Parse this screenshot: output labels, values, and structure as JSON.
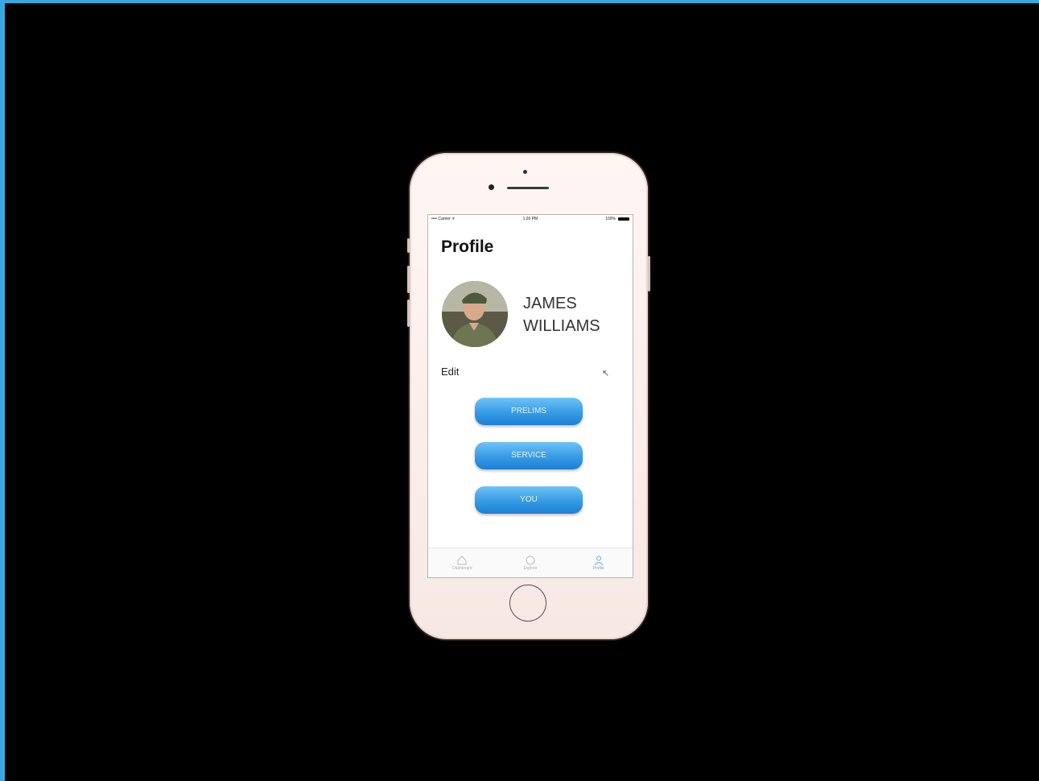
{
  "status_bar": {
    "carrier": "•••• Carrier ᯤ",
    "time": "1:20 PM",
    "battery": "100%"
  },
  "profile": {
    "title": "Profile",
    "first_name": "JAMES",
    "last_name": "WILLIAMS",
    "edit_label": "Edit"
  },
  "buttons": {
    "first": "PRELIMS",
    "second": "SERVICE",
    "third": "YOU"
  },
  "tabbar": {
    "tab1": "Dashboard",
    "tab2": "Explore",
    "tab3": "Profile"
  },
  "colors": {
    "frame_border": "#3aa8e0",
    "button_blue": "#3a9ee6",
    "phone_body": "#fbefec"
  }
}
